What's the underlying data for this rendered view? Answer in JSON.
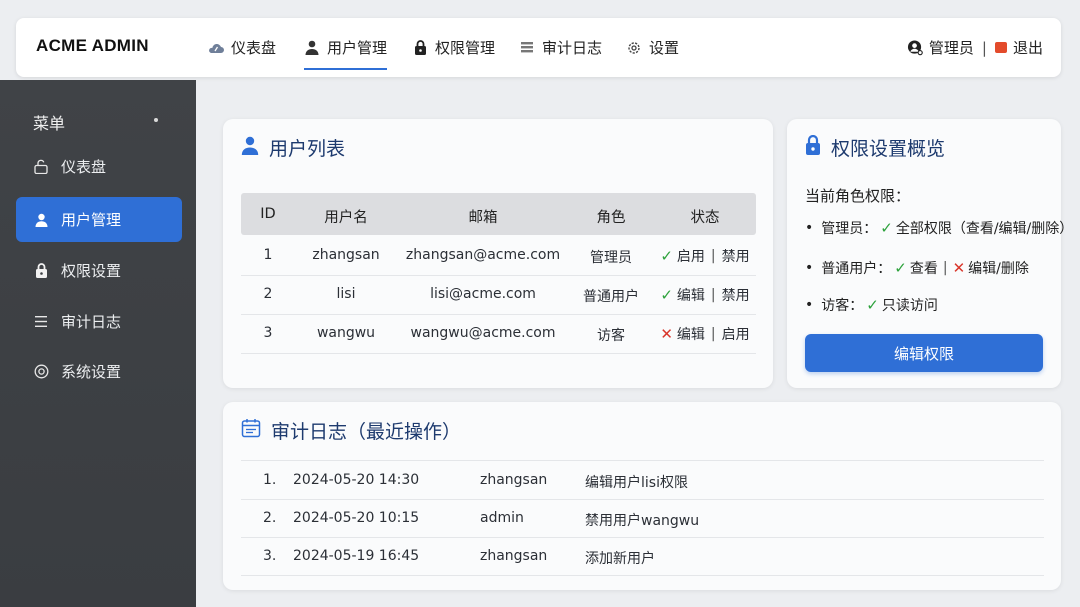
{
  "colors": {
    "accent": "#2f6fd6",
    "title_blue": "#1d3a6e",
    "success": "#2da23c",
    "danger": "#d9362b",
    "logout": "#e34b2b",
    "sidebar_bg": "#3d4044"
  },
  "header": {
    "brand": "ACME ADMIN",
    "nav": [
      {
        "label": "仪表盘",
        "icon": "cloud-dashboard-icon"
      },
      {
        "label": "用户管理",
        "icon": "user-icon",
        "active": true
      },
      {
        "label": "权限管理",
        "icon": "lock-icon"
      },
      {
        "label": "审计日志",
        "icon": "log-list-icon"
      },
      {
        "label": "设置",
        "icon": "gear-icon"
      }
    ],
    "user": {
      "name": "管理员",
      "separator": "|",
      "logout": "退出",
      "icon": "user-search-icon"
    }
  },
  "sidebar": {
    "title": "菜单",
    "items": [
      {
        "label": "仪表盘",
        "icon": "unlock-icon"
      },
      {
        "label": "用户管理",
        "icon": "user-icon",
        "active": true
      },
      {
        "label": "权限设置",
        "icon": "lock-icon"
      },
      {
        "label": "审计日志",
        "icon": "list-icon"
      },
      {
        "label": "系统设置",
        "icon": "settings-circle-icon"
      }
    ]
  },
  "users": {
    "title": "用户列表",
    "columns": [
      "ID",
      "用户名",
      "邮箱",
      "角色",
      "状态"
    ],
    "rows": [
      {
        "id": "1",
        "username": "zhangsan",
        "email": "zhangsan@acme.com",
        "role": "管理员",
        "status_mark": "✓",
        "status_a": "启用",
        "status_sep": "|",
        "status_b": "禁用"
      },
      {
        "id": "2",
        "username": "lisi",
        "email": "lisi@acme.com",
        "role": "普通用户",
        "status_mark": "✓",
        "status_a": "编辑",
        "status_sep": "|",
        "status_b": "禁用"
      },
      {
        "id": "3",
        "username": "wangwu",
        "email": "wangwu@acme.com",
        "role": "访客",
        "status_mark": "✕",
        "status_a": "编辑",
        "status_sep": "|",
        "status_b": "启用"
      }
    ]
  },
  "permissions": {
    "title": "权限设置概览",
    "subtitle": "当前角色权限：",
    "lines": [
      {
        "bullet": "•",
        "role": "管理员：",
        "mark1": "✓",
        "text1": "全部权限（查看/编辑/删除）"
      },
      {
        "bullet": "•",
        "role": "普通用户：",
        "mark1": "✓",
        "text1": "查看",
        "sep": "|",
        "mark2": "✕",
        "text2": "编辑/删除"
      },
      {
        "bullet": "•",
        "role": "访客：",
        "mark1": "✓",
        "text1": "只读访问"
      }
    ],
    "button": "编辑权限"
  },
  "audit": {
    "title": "审计日志（最近操作）",
    "rows": [
      {
        "num": "1.",
        "time": "2024-05-20 14:30",
        "user": "zhangsan",
        "action": "编辑用户lisi权限"
      },
      {
        "num": "2.",
        "time": "2024-05-20 10:15",
        "user": "admin",
        "action": "禁用用户wangwu"
      },
      {
        "num": "3.",
        "time": "2024-05-19 16:45",
        "user": "zhangsan",
        "action": "添加新用户"
      }
    ]
  }
}
